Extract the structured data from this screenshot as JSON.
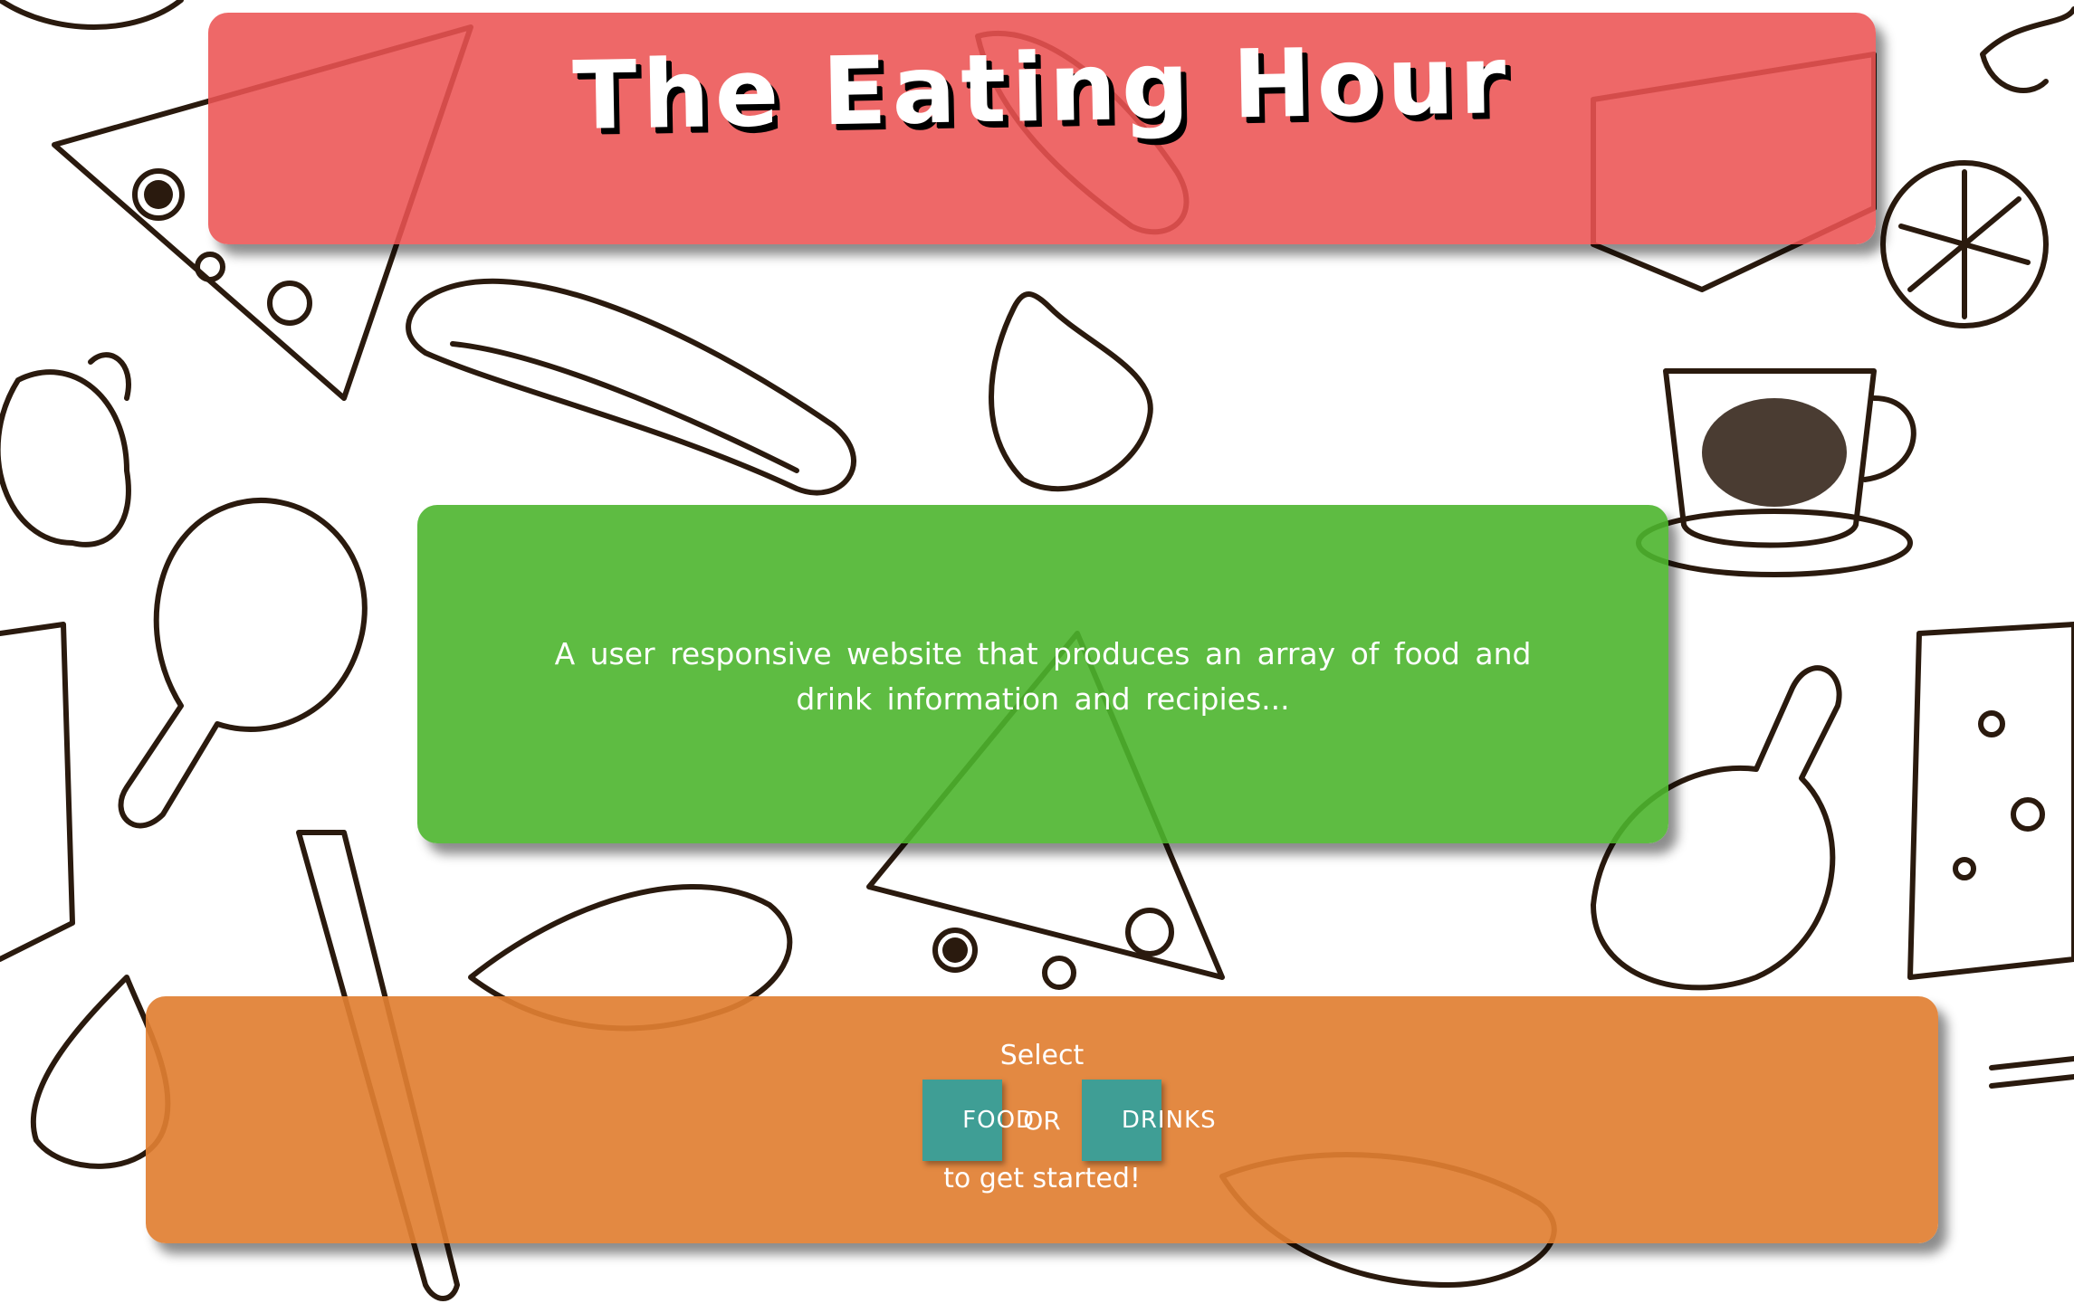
{
  "header": {
    "title": "The Eating Hour"
  },
  "description": {
    "text": "A user responsive website that produces an array of food and drink information and recipies..."
  },
  "actions": {
    "select_label": "Select",
    "food_button": "FOOD",
    "or_label": "OR",
    "drinks_button": "DRINKS",
    "started_label": "to get started!"
  },
  "colors": {
    "header_bg": "#ec5353",
    "description_bg": "#4db52d",
    "action_bg": "#e17f32",
    "button_bg": "#3f9e95",
    "text": "#ffffff"
  },
  "background": {
    "pattern": "hand-drawn food doodles"
  }
}
